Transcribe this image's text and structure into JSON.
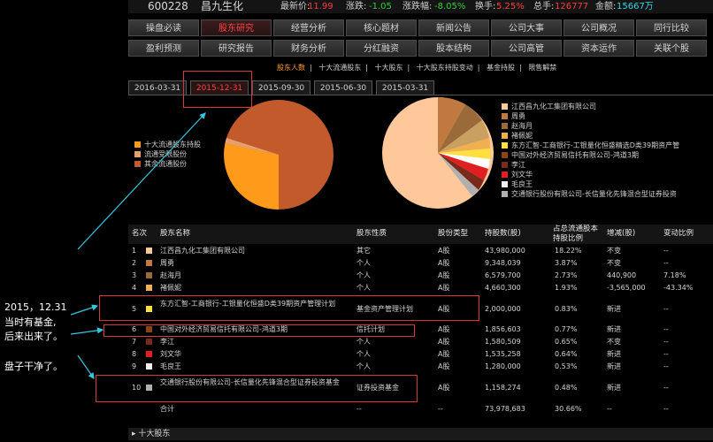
{
  "header": {
    "code": "600228",
    "name": "昌九生化",
    "latest_label": "最新价:",
    "latest": "11.99",
    "change_label": "涨跌:",
    "change": "-1.05",
    "pct_label": "涨跌幅:",
    "pct": "-8.05%",
    "turnover_label": "换手:",
    "turnover": "5.25%",
    "vol_label": "总手:",
    "vol": "126777",
    "amount_label": "金额:",
    "amount": "15667万"
  },
  "menu_row1": [
    "操盘必读",
    "股东研究",
    "经营分析",
    "核心题材",
    "新闻公告",
    "公司大事",
    "公司概况",
    "同行比较"
  ],
  "menu_row2": [
    "盈利预测",
    "研究报告",
    "财务分析",
    "分红融资",
    "股本结构",
    "公司高管",
    "资本运作",
    "关联个股"
  ],
  "subnav": [
    "股东人数",
    "十大流通股东",
    "十大股东",
    "十大股东持股变动",
    "基金持股",
    "限售解禁"
  ],
  "subnav_seps": [
    "|",
    "|",
    "|",
    "|",
    "|"
  ],
  "date_tabs": [
    "2016-03-31",
    "2015-12-31",
    "2015-09-30",
    "2015-06-30",
    "2015-03-31"
  ],
  "left_legend": [
    "十大流通股东持股",
    "流通受限股份",
    "其余流通股份"
  ],
  "right_legend": [
    "江西昌九化工集团有限公司",
    "周勇",
    "赵海月",
    "褚佩妮",
    "东方汇智-工商银行-工银量化恒盛精选D类39期资产管",
    "中国对外经济贸易信托有限公司-鸿道3期",
    "李江",
    "刘文华",
    "毛良王",
    "交通银行股份有限公司-长信量化先锋混合型证券投资"
  ],
  "colors": {
    "pie_left": [
      "#ff9a1a",
      "#e6a070",
      "#c25a2c"
    ],
    "pie_right": [
      "#ffc89a",
      "#c07a40",
      "#9a6a3a",
      "#f0b050",
      "#ffe040",
      "#8b4513",
      "#7a2a1a",
      "#e02020",
      "#f0f0f0",
      "#b0b0b0",
      "#fad4a8"
    ],
    "accent_red": "#ff4040",
    "box_red": "#d43a3a"
  },
  "table": {
    "headers": [
      "名次",
      "股东名称",
      "股东性质",
      "股份类型",
      "持股数(股)",
      "占总流通股本持股比例",
      "增减(股)",
      "变动比例"
    ],
    "rows": [
      [
        "1",
        "江西昌九化工集团有限公司",
        "其它",
        "A股",
        "43,980,000",
        "18.22%",
        "不变",
        "--"
      ],
      [
        "2",
        "周勇",
        "个人",
        "A股",
        "9,348,039",
        "3.87%",
        "不变",
        "--"
      ],
      [
        "3",
        "赵海月",
        "个人",
        "A股",
        "6,579,700",
        "2.73%",
        "440,900",
        "7.18%"
      ],
      [
        "4",
        "褚佩妮",
        "个人",
        "A股",
        "4,660,300",
        "1.93%",
        "-3,565,000",
        "-43.34%"
      ],
      [
        "5",
        "东方汇智-工商银行-工银量化恒盛D类39期资产管理计划",
        "基金资产管理计划",
        "A股",
        "2,000,000",
        "0.83%",
        "新进",
        "--"
      ],
      [
        "6",
        "中国对外经济贸易信托有限公司-鸿道3期",
        "信托计划",
        "A股",
        "1,856,603",
        "0.77%",
        "新进",
        "--"
      ],
      [
        "7",
        "李江",
        "个人",
        "A股",
        "1,580,509",
        "0.65%",
        "不变",
        "--"
      ],
      [
        "8",
        "刘文华",
        "个人",
        "A股",
        "1,535,258",
        "0.64%",
        "新进",
        "--"
      ],
      [
        "9",
        "毛良王",
        "个人",
        "A股",
        "1,280,000",
        "0.53%",
        "新进",
        "--"
      ],
      [
        "10",
        "交通银行股份有限公司-长信量化先锋混合型证券投资基金",
        "证券投资基金",
        "A股",
        "1,158,274",
        "0.48%",
        "新进",
        "--"
      ]
    ],
    "total": [
      "合计",
      "--",
      "--",
      "73,978,683",
      "30.66%",
      "--",
      "--"
    ]
  },
  "annotations": {
    "date_note": "2015，12.31",
    "line2": "当时有基金,",
    "line3": "后来出来了。",
    "clean": "盘子干净了。"
  },
  "bottom": {
    "arrow": "▸",
    "label": "十大股东"
  }
}
